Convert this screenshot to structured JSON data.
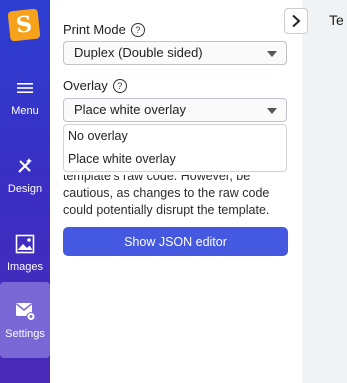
{
  "nav": {
    "logo_letter": "S",
    "items": [
      {
        "label": "Menu",
        "icon": "hamburger-icon"
      },
      {
        "label": "Design",
        "icon": "magic-wand-icon"
      },
      {
        "label": "Images",
        "icon": "image-icon"
      },
      {
        "label": "Settings",
        "icon": "settings-icon",
        "active": true
      }
    ]
  },
  "panel": {
    "print_mode": {
      "label": "Print Mode",
      "value": "Duplex (Double sided)"
    },
    "overlay": {
      "label": "Overlay",
      "value": "Place white overlay",
      "options": [
        "No overlay",
        "Place white overlay"
      ]
    },
    "description": {
      "line1": "template's raw code. However, be",
      "line2": "cautious, as changes to the raw code",
      "line3": "could potentially disrupt the template."
    },
    "json_button": "Show JSON editor"
  },
  "right": {
    "text": "Te"
  },
  "colors": {
    "rail": "#3a2fc4",
    "accent": "#4458e0",
    "logo": "#f7a21b"
  }
}
